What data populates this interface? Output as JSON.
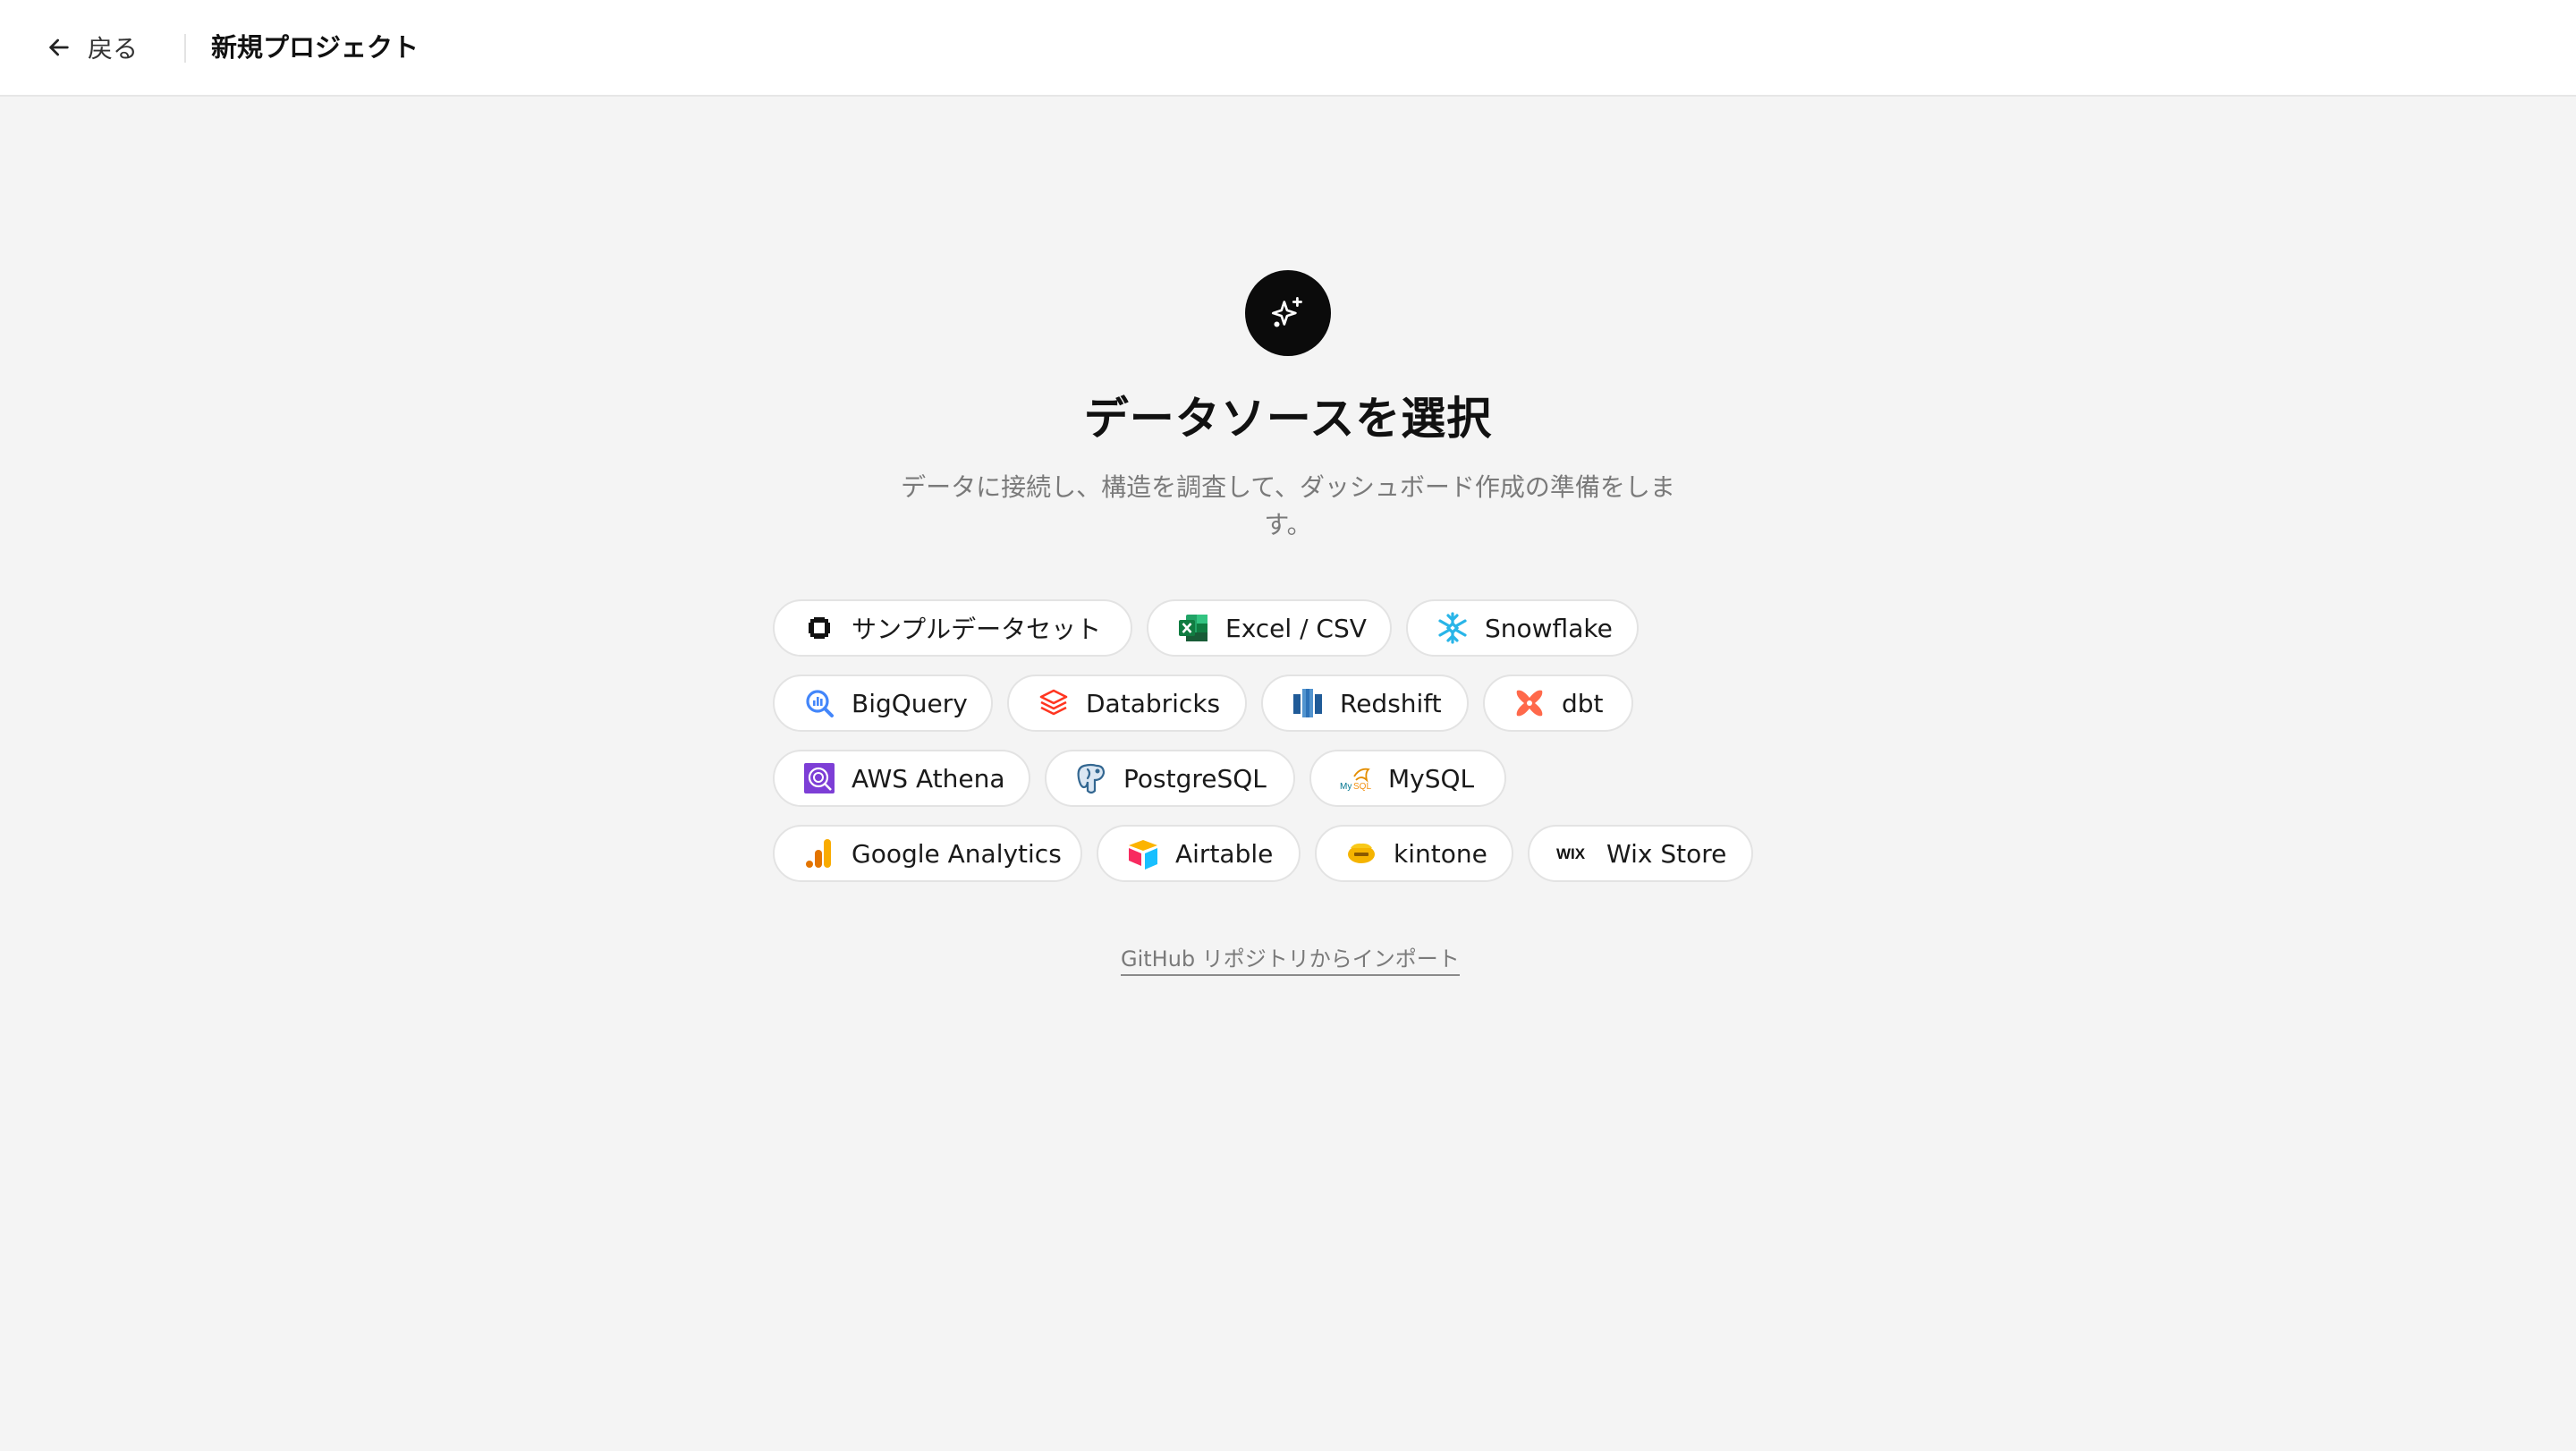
{
  "header": {
    "back_label": "戻る",
    "page_title": "新規プロジェクト"
  },
  "main": {
    "title": "データソースを選択",
    "subtitle": "データに接続し、構造を調査して、ダッシュボード作成の準備をします。"
  },
  "sources": [
    {
      "label": "サンプルデータセット",
      "icon": "sample-dataset-icon"
    },
    {
      "label": "Excel / CSV",
      "icon": "excel-icon"
    },
    {
      "label": "Snowflake",
      "icon": "snowflake-icon"
    },
    {
      "label": "BigQuery",
      "icon": "bigquery-icon"
    },
    {
      "label": "Databricks",
      "icon": "databricks-icon"
    },
    {
      "label": "Redshift",
      "icon": "redshift-icon"
    },
    {
      "label": "dbt",
      "icon": "dbt-icon"
    },
    {
      "label": "AWS Athena",
      "icon": "aws-athena-icon"
    },
    {
      "label": "PostgreSQL",
      "icon": "postgresql-icon"
    },
    {
      "label": "MySQL",
      "icon": "mysql-icon"
    },
    {
      "label": "Google Analytics",
      "icon": "google-analytics-icon"
    },
    {
      "label": "Airtable",
      "icon": "airtable-icon"
    },
    {
      "label": "kintone",
      "icon": "kintone-icon"
    },
    {
      "label": "Wix Store",
      "icon": "wix-icon"
    }
  ],
  "github_link": "GitHub リポジトリからインポート",
  "colors": {
    "background": "#f4f4f4",
    "header_bg": "#ffffff",
    "hero_icon_bg": "#0b0b0b",
    "chip_border": "#e3e3e3",
    "muted_text": "#7a7a7a"
  }
}
